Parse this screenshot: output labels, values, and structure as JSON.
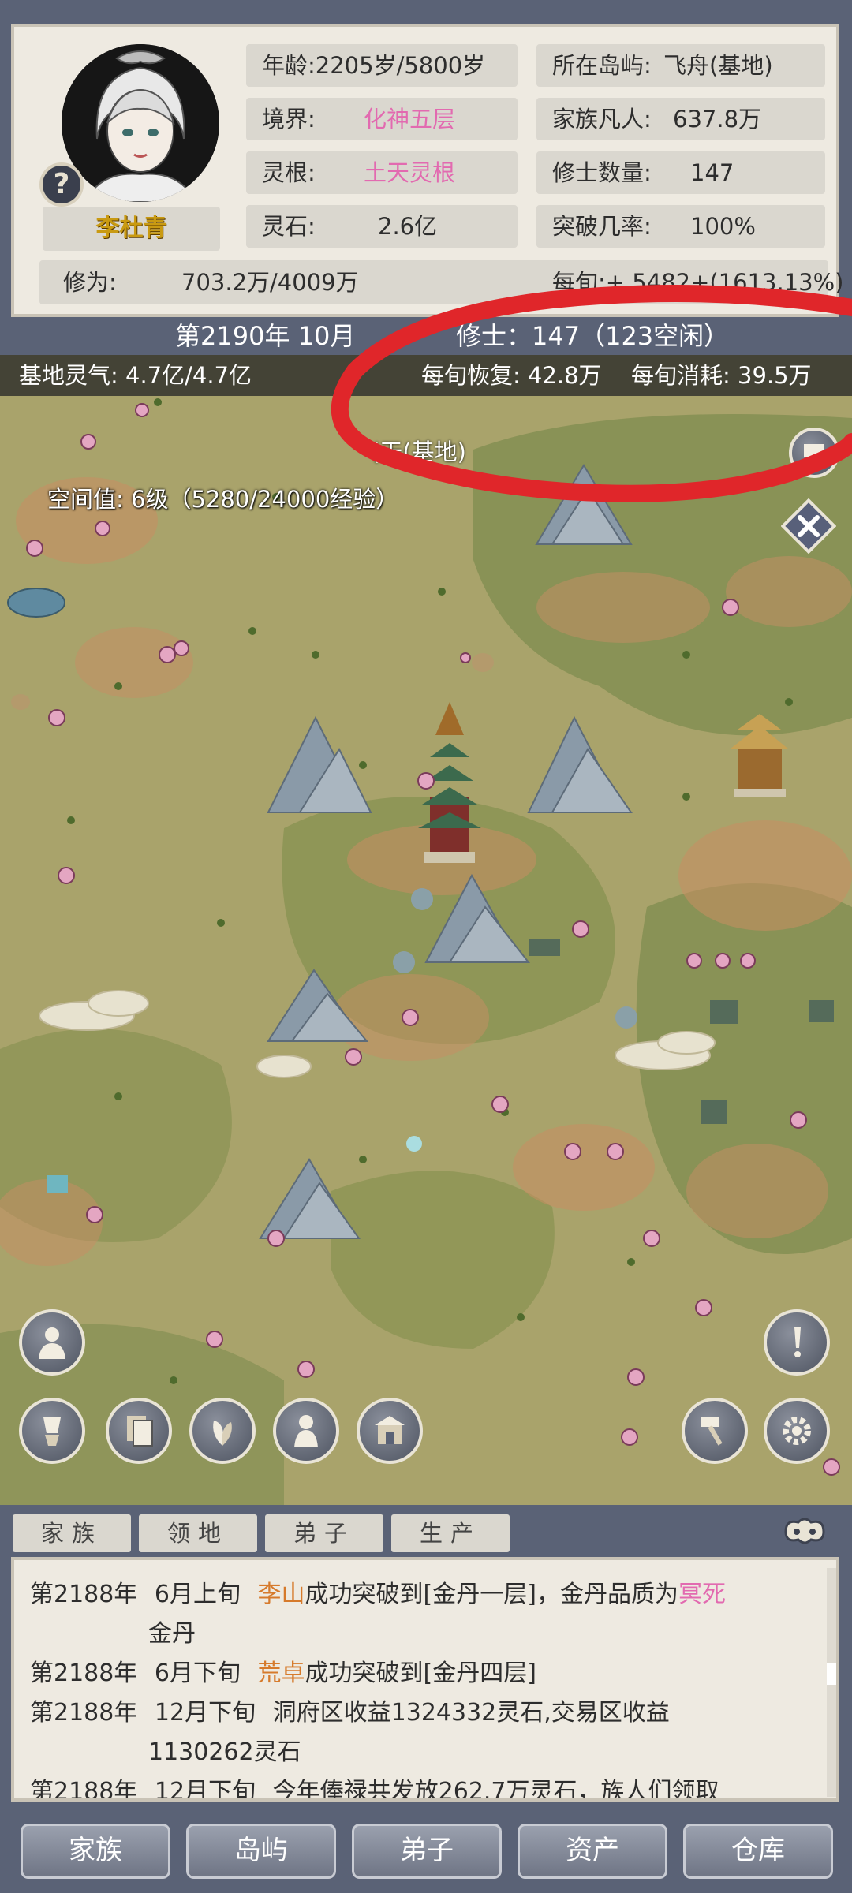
{
  "profile": {
    "name": "李杜青",
    "age": "年龄:2205岁/5800岁",
    "island_label": "所在岛屿:",
    "island_value": "飞舟(基地)",
    "realm_label": "境界:",
    "realm_value": "化神五层",
    "family_label": "家族凡人:",
    "family_value": "637.8万",
    "root_label": "灵根:",
    "root_value": "土天灵根",
    "cultivators_label": "修士数量:",
    "cultivators_value": "147",
    "stones_label": "灵石:",
    "stones_value": "2.6亿",
    "breakthrough_label": "突破几率:",
    "breakthrough_value": "100%",
    "cultivation_label": "修为:",
    "cultivation_value": "703.2万/4009万",
    "per_period": "每旬:+ 5482+(1613.13%)",
    "help_icon": "?"
  },
  "status": {
    "year_line": "第2190年 10月",
    "cultivator_line": "修士：147（123空闲）"
  },
  "map": {
    "qi_label": "基地灵气: 4.7亿/4.7亿",
    "recovery": "每旬恢复: 42.8万",
    "consumption": "每旬消耗: 39.5万",
    "space_value": "空间值: 6级（5280/24000经验）",
    "partial_label": "(天(基地)"
  },
  "tabs": [
    "家族",
    "领地",
    "弟子",
    "生产"
  ],
  "log": [
    {
      "date": "第2188年",
      "period": "6月上旬",
      "name": "李山",
      "text": "成功突破到[金丹一层]，金丹品质为",
      "quality": "冥死",
      "cont": "金丹"
    },
    {
      "date": "第2188年",
      "period": "6月下旬",
      "name": "荒卓",
      "text": "成功突破到[金丹四层]"
    },
    {
      "date": "第2188年",
      "period": "12月下旬",
      "text": "洞府区收益1324332灵石,交易区收益",
      "cont": "1130262灵石"
    },
    {
      "date": "第2188年",
      "period": "12月下旬",
      "text": "今年俸禄共发放262.7万灵石，族人们领取"
    }
  ],
  "nav": [
    "家族",
    "岛屿",
    "弟子",
    "资产",
    "仓库"
  ],
  "colors": {
    "accent_pink": "#e26ab0",
    "name_gold": "#c99a12",
    "annotation_red": "#e0262a"
  }
}
